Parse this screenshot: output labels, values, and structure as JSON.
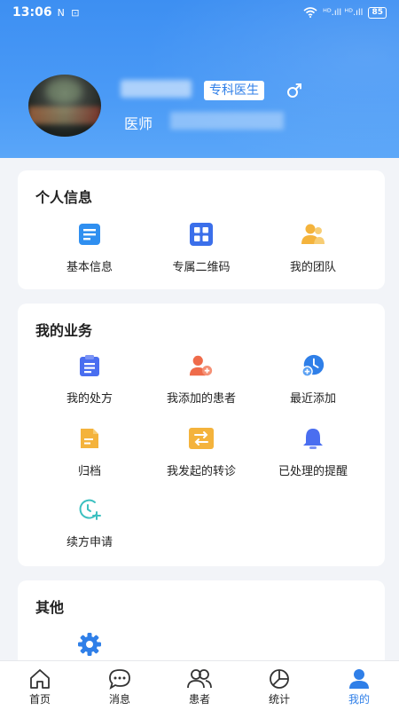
{
  "status": {
    "time": "13:06",
    "left_icons": "N ⊡",
    "signal": "ᴴᴰ.ıll ᴴᴰ.ıll",
    "battery": "85"
  },
  "profile": {
    "badge": "专科医生",
    "role": "医师"
  },
  "personal": {
    "title": "个人信息",
    "items": [
      {
        "label": "基本信息",
        "icon": "document-icon"
      },
      {
        "label": "专属二维码",
        "icon": "qrcode-icon"
      },
      {
        "label": "我的团队",
        "icon": "team-icon"
      }
    ]
  },
  "business": {
    "title": "我的业务",
    "items": [
      {
        "label": "我的处方",
        "icon": "clipboard-icon"
      },
      {
        "label": "我添加的患者",
        "icon": "add-patient-icon"
      },
      {
        "label": "最近添加",
        "icon": "recent-icon"
      },
      {
        "label": "归档",
        "icon": "archive-icon"
      },
      {
        "label": "我发起的转诊",
        "icon": "transfer-icon"
      },
      {
        "label": "已处理的提醒",
        "icon": "bell-icon"
      },
      {
        "label": "续方申请",
        "icon": "renewal-icon"
      }
    ]
  },
  "other": {
    "title": "其他",
    "items": [
      {
        "icon": "settings-gear-icon"
      }
    ]
  },
  "tabbar": {
    "items": [
      {
        "label": "首页",
        "icon": "home-icon"
      },
      {
        "label": "消息",
        "icon": "message-icon"
      },
      {
        "label": "患者",
        "icon": "patients-icon"
      },
      {
        "label": "统计",
        "icon": "statistics-icon"
      },
      {
        "label": "我的",
        "icon": "profile-icon"
      }
    ],
    "active_index": 4
  },
  "colors": {
    "accent": "#2f7fe8",
    "header": "#4a9af6",
    "orange": "#f4b33c",
    "red": "#ef6b4a",
    "teal": "#3cc0c0",
    "indigo": "#5566e8"
  }
}
